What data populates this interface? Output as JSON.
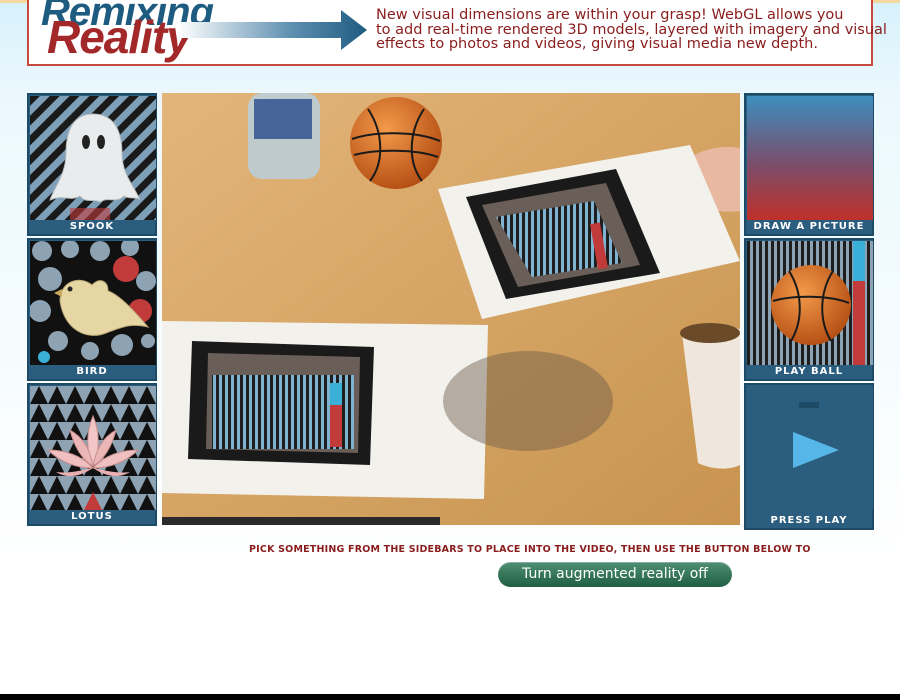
{
  "header": {
    "logo_word1": "Remixing",
    "logo_word2": "Reality",
    "tagline_lines": [
      "New visual dimensions are within your grasp! WebGL allows you",
      "to add real-time rendered 3D models, layered with imagery and visual",
      "effects to photos and videos, giving visual media new depth."
    ]
  },
  "left_sidebar": {
    "items": [
      {
        "label": "SPOOK",
        "icon": "ghost-icon"
      },
      {
        "label": "BIRD",
        "icon": "bird-icon"
      },
      {
        "label": "LOTUS",
        "icon": "lotus-icon"
      }
    ]
  },
  "right_sidebar": {
    "items": [
      {
        "label": "DRAW A PICTURE",
        "icon": "gradient-canvas-icon"
      },
      {
        "label": "PLAY BALL",
        "icon": "basketball-icon"
      },
      {
        "label": "PRESS PLAY",
        "icon": "play-icon"
      }
    ]
  },
  "main": {
    "instruction": "PICK SOMETHING FROM THE SIDEBARS TO PLACE INTO THE VIDEO, THEN USE THE BUTTON BELOW TO",
    "toggle_button": "Turn augmented reality off"
  },
  "colors": {
    "brand_blue": "#1e5b80",
    "brand_red": "#a3282a",
    "tile_blue": "#2b5d7e",
    "button_green": "#2f7556"
  }
}
